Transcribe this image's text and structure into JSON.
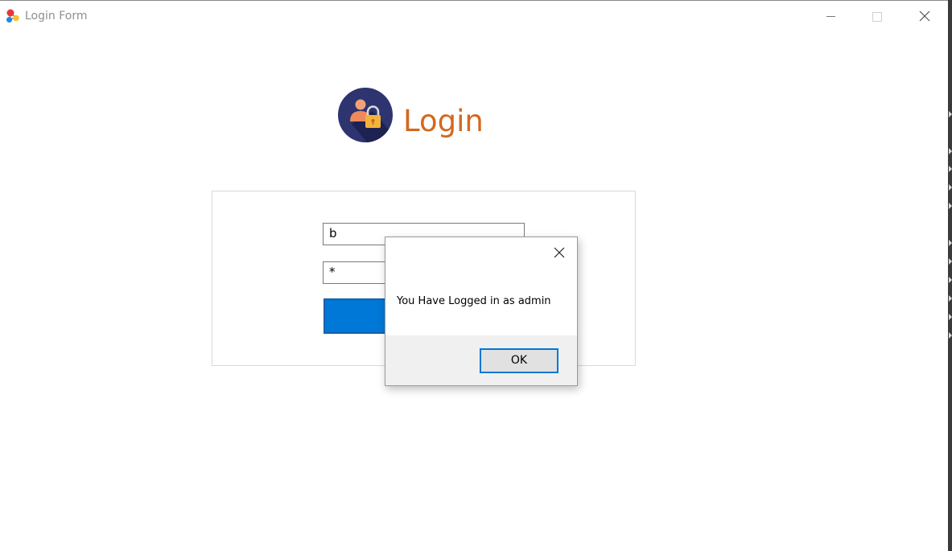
{
  "window": {
    "title": "Login Form",
    "icon": "app-molecule-icon",
    "controls": [
      "minimize-icon",
      "maximize-icon",
      "close-icon"
    ]
  },
  "header": {
    "logo_icon": "user-lock-icon",
    "title": "Login"
  },
  "form": {
    "username_value": "b",
    "password_value": "*",
    "login_button_color": "#0078d7"
  },
  "dialog": {
    "message": "You Have Logged in as admin",
    "ok_label": "OK",
    "close_icon": "close-icon"
  },
  "colors": {
    "heading": "#d2691e",
    "accent": "#0078d7",
    "logo_bg": "#2d3470"
  }
}
